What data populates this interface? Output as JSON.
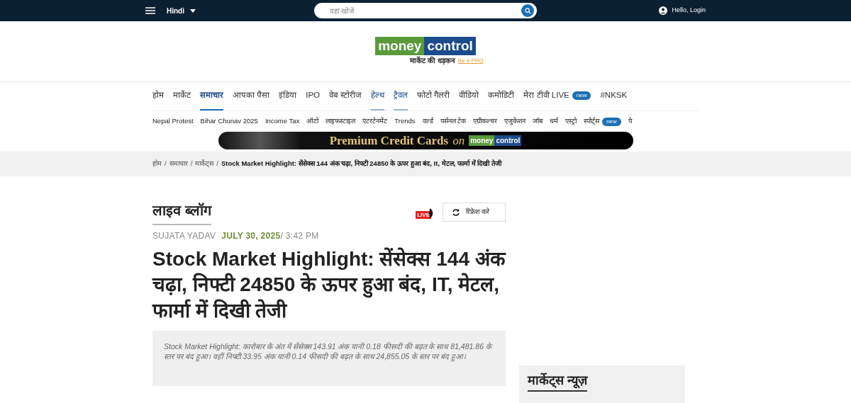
{
  "topbar": {
    "language": "Hindi",
    "search": {
      "placeholder": "यहां खोजें"
    },
    "login": "Hello, Login"
  },
  "logo": {
    "part_1": "money",
    "part_2": "control",
    "tagline": "मार्केट की धड़कन",
    "pro_link": "Be a PRO"
  },
  "main_nav": [
    {
      "label": "होम",
      "selected": false,
      "highlighted": false
    },
    {
      "label": "मार्केट",
      "selected": false,
      "highlighted": false
    },
    {
      "label": "समाचार",
      "selected": true,
      "highlighted": false
    },
    {
      "label": "आपका पैसा",
      "selected": false,
      "highlighted": false
    },
    {
      "label": "इंडिया",
      "selected": false,
      "highlighted": false
    },
    {
      "label": "IPO",
      "selected": false,
      "highlighted": false
    },
    {
      "label": "वेब स्टोरीज",
      "selected": false,
      "highlighted": false
    },
    {
      "label": "हेल्थ",
      "selected": false,
      "highlighted": true
    },
    {
      "label": "ट्रैवल",
      "selected": false,
      "highlighted": true
    },
    {
      "label": "फोटो गैलरी",
      "selected": false,
      "highlighted": false
    },
    {
      "label": "वीडियो",
      "selected": false,
      "highlighted": false
    },
    {
      "label": "कमोडिटी",
      "selected": false,
      "highlighted": false
    },
    {
      "label": "मेरा टीवी LIVE",
      "selected": false,
      "highlighted": false,
      "badge": "new"
    },
    {
      "label": "#NKSK",
      "selected": false,
      "highlighted": false
    }
  ],
  "sub_nav": [
    {
      "label": "Nepal Protest"
    },
    {
      "label": "Bihar Chunav 2025"
    },
    {
      "label": "Income Tax"
    },
    {
      "label": "ऑटो"
    },
    {
      "label": "लाइफस्टाइल"
    },
    {
      "label": "एंटरटेनमेंट"
    },
    {
      "label": "Trends"
    },
    {
      "label": "वर्ल्ड"
    },
    {
      "label": "पर्सनल टेक"
    },
    {
      "label": "एग्रीकल्चर"
    },
    {
      "label": "एजुकेशन"
    },
    {
      "label": "जॉब"
    },
    {
      "label": "धर्म"
    },
    {
      "label": "एस्ट्रो"
    },
    {
      "label": "स्पोर्ट्स",
      "badge": "new"
    },
    {
      "label": "पे"
    }
  ],
  "banner": {
    "text": "Premium Credit Cards",
    "connector": "on",
    "logo_part_1": "money",
    "logo_part_2": "control"
  },
  "breadcrumb_separator": "/",
  "breadcrumb": [
    "होम",
    "समाचार",
    "मार्केट्स",
    "Stock Market Highlight: सेंसेक्स 144 अंक चढ़ा, निफ्टी 24850 के ऊपर हुआ बंद, It, मेटल, फार्मा में दिखी तेजी"
  ],
  "article": {
    "section": "लाइव ब्लॉग",
    "live_badge": "LIVE",
    "refresh_button": "रिफ्रेश करे",
    "author": "SUJATA YADAV",
    "date": "JULY 30, 2025",
    "time": "/ 3:42 PM",
    "headline": "Stock Market Highlight: सेंसेक्स 144 अंक चढ़ा, निफ्टी 24850 के ऊपर हुआ बंद, IT, मेटल, फार्मा में दिखी तेजी",
    "summary": "Stock Market Highlight: कारोबार के अंत में सेंसेक्स 143.91 अंक यानी 0.18 फीसदी की बढ़त के साथ 81,481.86 के स्तर पर बंद हुआ। वहीं निफ्टी 33.95 अंक यानी 0.14 फीसदी की बढ़त के साथ 24,855.05 के स्तर पर बंद हुआ।"
  },
  "sidebar": {
    "title": "मार्केट्स न्यूज़"
  }
}
